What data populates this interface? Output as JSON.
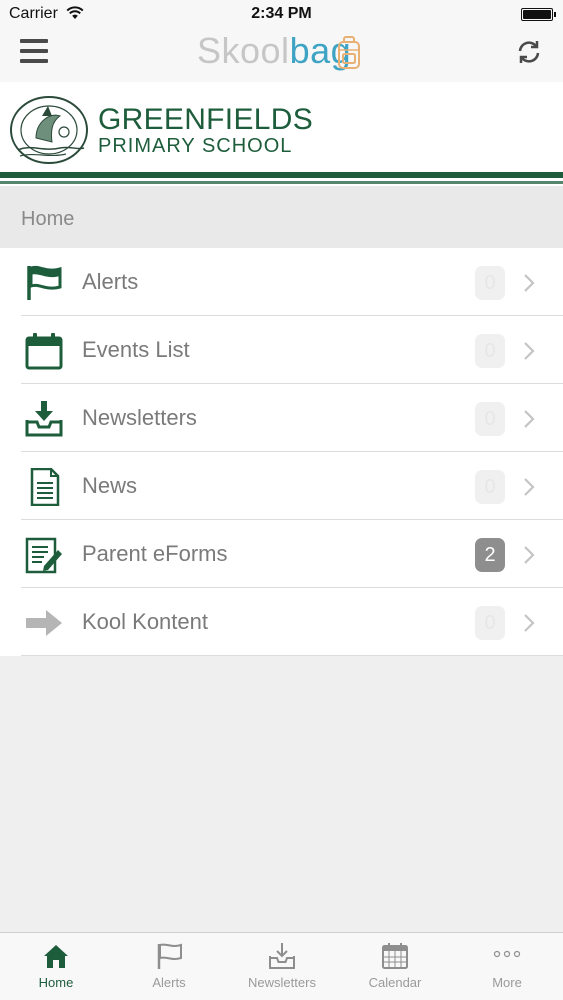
{
  "status_bar": {
    "carrier": "Carrier",
    "time": "2:34 PM"
  },
  "header": {
    "brand_a": "Skool",
    "brand_b": "bag"
  },
  "school": {
    "name": "GREENFIELDS",
    "subtitle": "PRIMARY SCHOOL"
  },
  "section": {
    "title": "Home"
  },
  "colors": {
    "accent": "#1e5d3c",
    "brand_blue": "#3fa3c4",
    "brand_gray": "#c6c6c6"
  },
  "menu": [
    {
      "label": "Alerts",
      "badge": "0",
      "icon": "flag-icon"
    },
    {
      "label": "Events List",
      "badge": "0",
      "icon": "calendar-icon"
    },
    {
      "label": "Newsletters",
      "badge": "0",
      "icon": "inbox-download-icon"
    },
    {
      "label": "News",
      "badge": "0",
      "icon": "document-icon"
    },
    {
      "label": "Parent eForms",
      "badge": "2",
      "icon": "form-edit-icon"
    },
    {
      "label": "Kool Kontent",
      "badge": "0",
      "icon": "arrow-right-icon"
    }
  ],
  "tabs": [
    {
      "label": "Home",
      "icon": "home-icon",
      "active": true
    },
    {
      "label": "Alerts",
      "icon": "flag-icon"
    },
    {
      "label": "Newsletters",
      "icon": "inbox-download-icon"
    },
    {
      "label": "Calendar",
      "icon": "calendar-icon"
    },
    {
      "label": "More",
      "icon": "more-dots-icon"
    }
  ]
}
